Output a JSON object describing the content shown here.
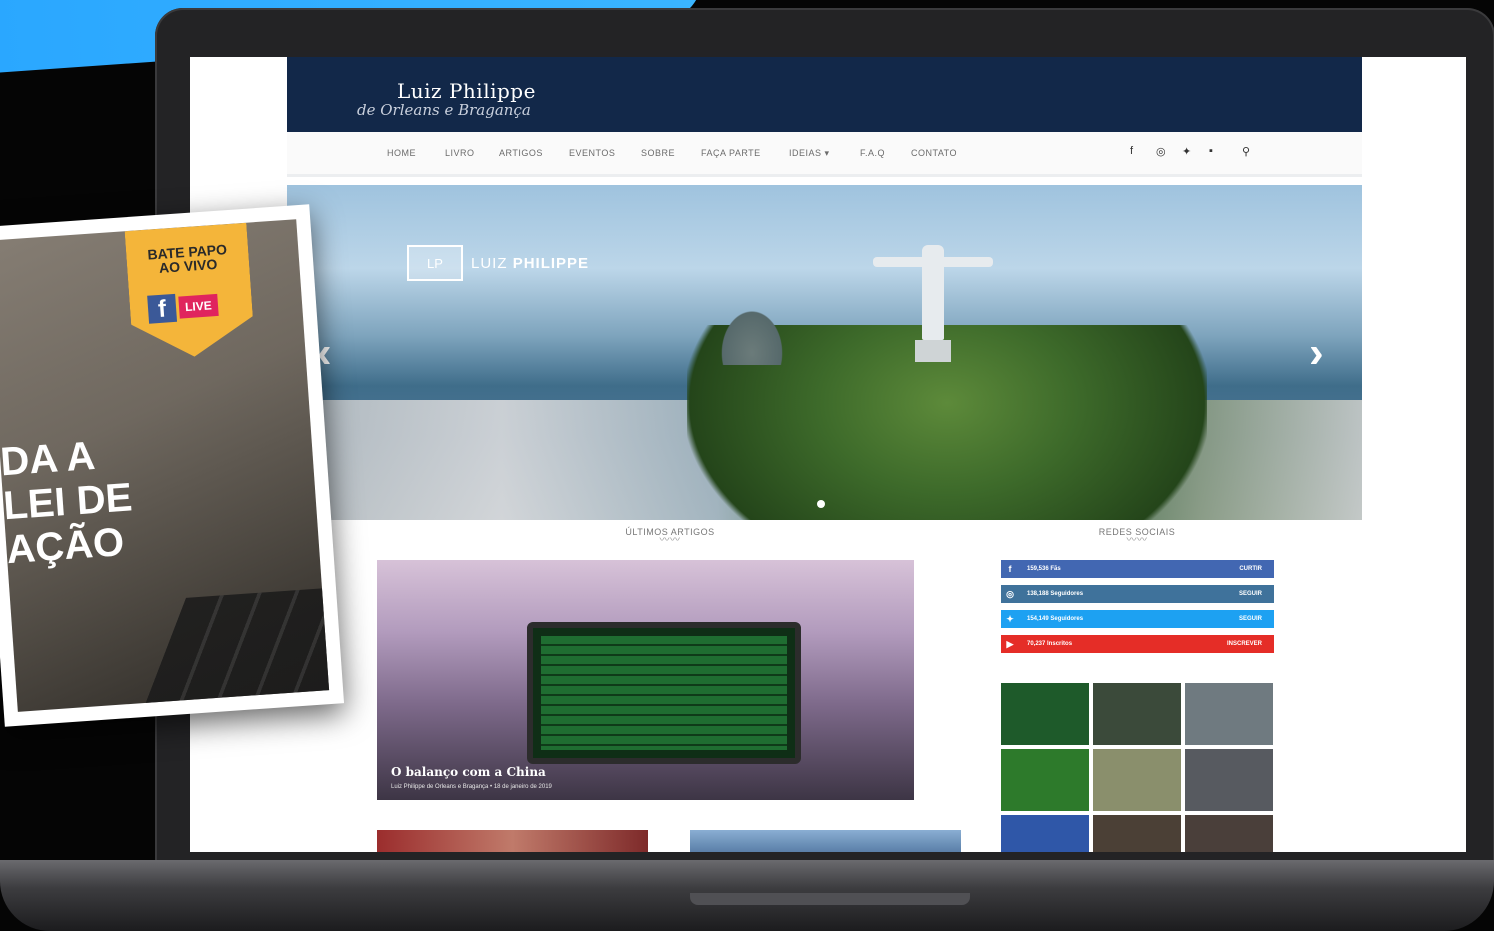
{
  "site": {
    "logo_main": "Luiz Philippe",
    "logo_sub": "de Orleans e Bragança",
    "nav": [
      "HOME",
      "LIVRO",
      "ARTIGOS",
      "EVENTOS",
      "SOBRE",
      "FAÇA PARTE",
      "IDEIAS ▾",
      "F.A.Q",
      "CONTATO"
    ],
    "nav_social_icons": [
      "facebook-icon",
      "instagram-icon",
      "twitter-icon",
      "youtube-icon",
      "search-icon"
    ]
  },
  "hero": {
    "badge_box": "LP",
    "badge_first": "LUIZ",
    "badge_last": "PHILIPPE",
    "prev_arrow": "‹",
    "next_arrow": "›"
  },
  "sections": {
    "articles_title": "ÚLTIMOS ARTIGOS",
    "social_title": "REDES SOCIAIS",
    "squiggle": "〰〰"
  },
  "article": {
    "title": "O balanço com a China",
    "meta": "Luiz Philippe de Orleans e Bragança • 18 de janeiro de 2019"
  },
  "social": [
    {
      "icon": "f",
      "count": "159,536 Fãs",
      "action": "CURTIR",
      "color": "#4267b2"
    },
    {
      "icon": "◎",
      "count": "138,188 Seguidores",
      "action": "SEGUIR",
      "color": "#3f729b"
    },
    {
      "icon": "✦",
      "count": "154,149 Seguidores",
      "action": "SEGUIR",
      "color": "#1da1f2"
    },
    {
      "icon": "▶",
      "count": "70,237 Inscritos",
      "action": "INSCREVER",
      "color": "#e52d27"
    }
  ],
  "gallery_colors": [
    "#1e5a2a",
    "#3b4a3a",
    "#6f7a80",
    "#2d7a2b",
    "#8a8f6c",
    "#575a60",
    "#2f57a8",
    "#4b4036",
    "#4a3f3a"
  ],
  "live_card": {
    "bate_papo": "BATE PAPO",
    "ao_vivo": "AO VIVO",
    "fb_letter": "f",
    "live_label": "LIVE",
    "headline": "DA A\nLEI DE\nAÇÃO"
  },
  "colors": {
    "header_navy": "#122849",
    "accent_blue": "#29a6ff",
    "badge_yellow": "#f4b53a"
  }
}
